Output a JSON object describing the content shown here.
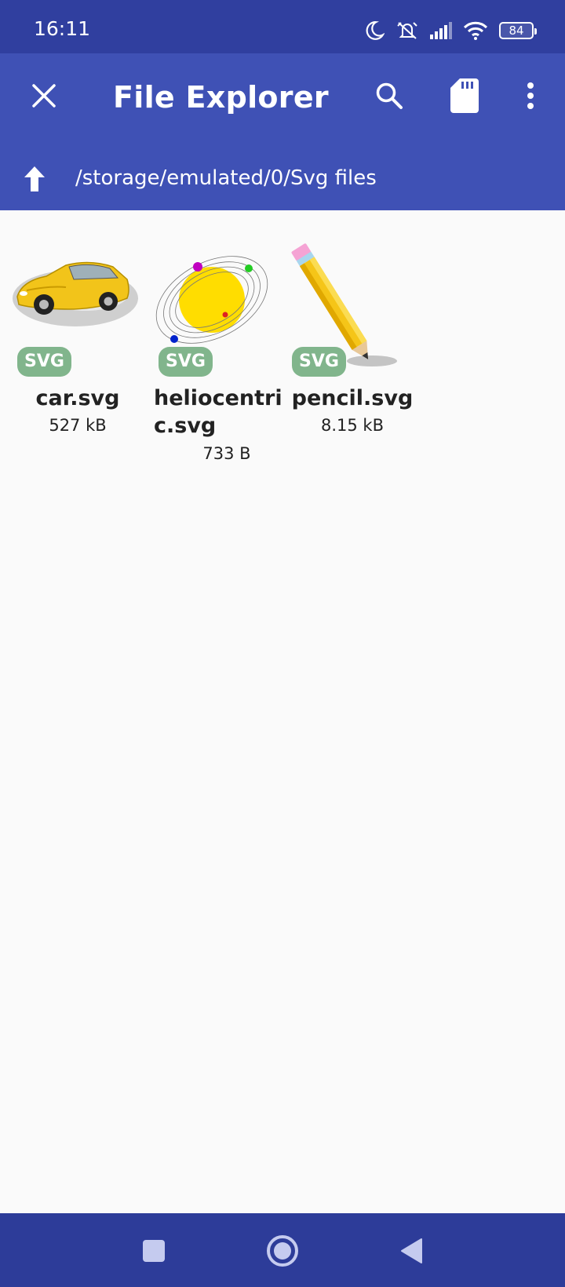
{
  "status_bar": {
    "time": "16:11",
    "battery": "84",
    "icons": [
      "moon-icon",
      "mute-alarm-icon",
      "signal-icon",
      "wifi-icon",
      "battery-icon"
    ]
  },
  "app_bar": {
    "title": "File Explorer",
    "path": "/storage/emulated/0/Svg files",
    "actions": [
      "close-icon",
      "search-icon",
      "sd-card-icon",
      "more-vert-icon",
      "arrow-up-icon"
    ]
  },
  "files": [
    {
      "name": "car.svg",
      "size": "527 kB",
      "badge": "SVG",
      "thumb": "car-thumbnail"
    },
    {
      "name": "heliocentric.svg",
      "name_line1": "heliocentri",
      "name_line2": "c.svg",
      "size": "733 B",
      "badge": "SVG",
      "thumb": "heliocentric-thumbnail"
    },
    {
      "name": "pencil.svg",
      "size": "8.15 kB",
      "badge": "SVG",
      "thumb": "pencil-thumbnail"
    }
  ],
  "nav_bar": {
    "buttons": [
      "recent-apps-icon",
      "home-icon",
      "back-icon"
    ]
  },
  "colors": {
    "status_bar": "#303f9f",
    "app_bar": "#3f51b5",
    "nav_bar": "#2d3c99",
    "badge": "#81b58c",
    "background": "#fafafa"
  }
}
